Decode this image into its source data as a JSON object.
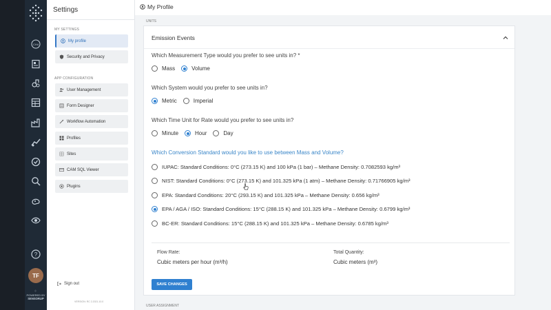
{
  "rail": {
    "user_initials": "TF",
    "powered_by": "POWERED BY",
    "brand": "SENSORUP",
    "icons": [
      "ghg-icon",
      "report-icon",
      "emission-icon",
      "table-icon",
      "factory-icon",
      "chart-icon",
      "checklist-icon",
      "search-icon",
      "map-icon",
      "eye-icon"
    ]
  },
  "sidebar": {
    "title": "Settings",
    "sections": {
      "my_settings": "MY SETTINGS",
      "app_config": "APP CONFIGURATION"
    },
    "items": [
      {
        "label": "My profile",
        "icon": "user-circle-icon"
      },
      {
        "label": "Security and Privacy",
        "icon": "shield-icon"
      },
      {
        "label": "User Management",
        "icon": "users-icon"
      },
      {
        "label": "Form Designer",
        "icon": "form-icon"
      },
      {
        "label": "Workflow Automation",
        "icon": "wand-icon"
      },
      {
        "label": "Profiles",
        "icon": "grid-icon"
      },
      {
        "label": "Sites",
        "icon": "sites-icon"
      },
      {
        "label": "CAM SQL Viewer",
        "icon": "database-icon"
      },
      {
        "label": "Plugins",
        "icon": "plugin-icon"
      }
    ],
    "sign_out": "Sign out",
    "version": "VERSION: RC 2.2021.10.0"
  },
  "topbar": {
    "title": "My Profile"
  },
  "units_label": "UNITS",
  "user_assignment_label": "USER ASSIGNMENT",
  "card": {
    "title": "Emission Events",
    "q1": {
      "text": "Which Measurement Type would you prefer to see units in? *",
      "options": [
        "Mass",
        "Volume"
      ],
      "selected": "Volume"
    },
    "q2": {
      "text": "Which System would you prefer to see units in?",
      "options": [
        "Metric",
        "Imperial"
      ],
      "selected": "Metric"
    },
    "q3": {
      "text": "Which Time Unit for Rate would you prefer to see units in?",
      "options": [
        "Minute",
        "Hour",
        "Day"
      ],
      "selected": "Hour"
    },
    "q4": {
      "text": "Which Conversion Standard would you like to use between Mass and Volume?",
      "options": [
        "IUPAC: Standard Conditions: 0°C (273.15 K) and 100 kPa (1 bar) – Methane Density: 0.7082593 kg/m³",
        "NIST: Standard Conditions: 0°C (273.15 K) and 101.325 kPa (1 atm) – Methane Density: 0.71766905 kg/m³",
        "EPA: Standard Conditions: 20°C (293.15 K) and 101.325 kPa – Methane Density: 0.656 kg/m³",
        "EPA / AGA / ISO: Standard Conditions: 15°C (288.15 K) and 101.325 kPa – Methane Density: 0.6799 kg/m³",
        "BC-ER: Standard Conditions: 15°C (288.15 K) and 101.325 kPa – Methane Density: 0.6785 kg/m³"
      ],
      "selected_index": 3
    },
    "summary": {
      "flow_rate_label": "Flow Rate:",
      "flow_rate_value": "Cubic meters per hour (m³/h)",
      "total_quantity_label": "Total Quantity:",
      "total_quantity_value": "Cubic meters (m³)"
    },
    "save_label": "SAVE CHANGES"
  },
  "colors": {
    "accent": "#2f80d0",
    "rail": "#1f2a36",
    "avatar": "#9a6b4c"
  }
}
